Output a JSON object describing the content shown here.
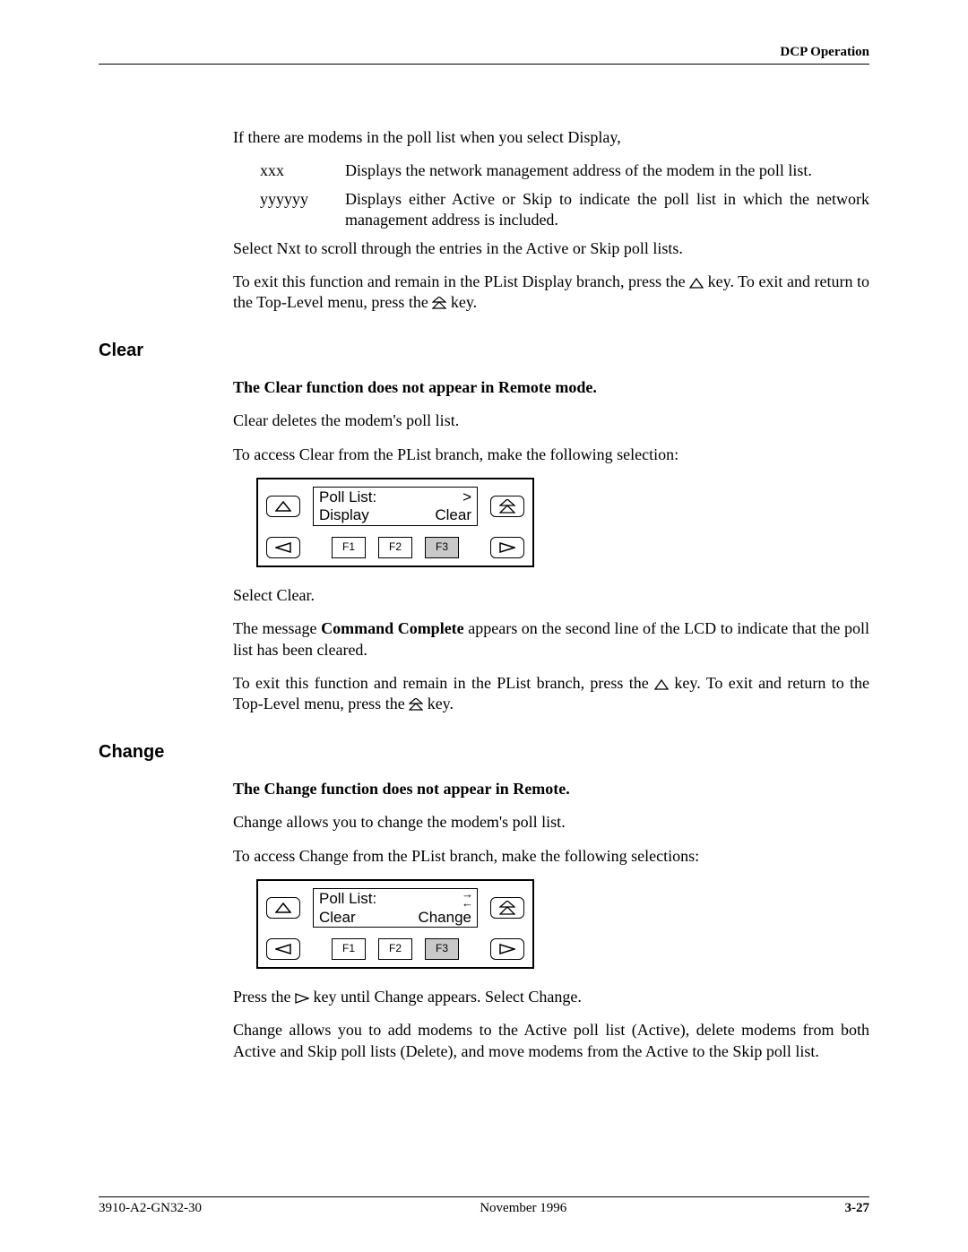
{
  "header": {
    "title": "DCP Operation"
  },
  "intro": {
    "p1": "If there are modems in the poll list when you select Display,",
    "defs": [
      {
        "term": "xxx",
        "def": "Displays the network management address of the modem in the poll list."
      },
      {
        "term": "yyyyyy",
        "def": "Displays either Active or Skip to indicate the poll list in which the network management address is included."
      }
    ],
    "p2": "Select Nxt to scroll through the entries in the Active or Skip poll lists.",
    "p3a": "To exit this function and remain in the PList Display branch, press the ",
    "p3b": " key. To exit and return to the Top-Level menu, press the ",
    "p3c": " key."
  },
  "clear": {
    "heading": "Clear",
    "note": "The Clear function does not appear in Remote mode.",
    "p1": "Clear deletes the modem's poll list.",
    "p2": "To access Clear from the PList branch, make the following selection:",
    "panel": {
      "line1_left": "Poll  List:",
      "line1_right": ">",
      "line2_left": "Display",
      "line2_right": "Clear",
      "f1": "F1",
      "f2": "F2",
      "f3": "F3",
      "selected": "F3"
    },
    "p3": "Select Clear.",
    "p4a": "The message ",
    "p4b": "Command Complete",
    "p4c": " appears on the second line of the LCD to indicate that the poll list has been cleared.",
    "p5a": "To exit this function and remain in the PList branch, press the ",
    "p5b": " key. To exit and return to the Top-Level menu, press the ",
    "p5c": " key."
  },
  "change": {
    "heading": "Change",
    "note": "The Change function does not appear in Remote.",
    "p1": "Change allows you to change the modem's poll list.",
    "p2": "To access Change from the PList branch, make the following selections:",
    "panel": {
      "line1_left": "Poll  List:",
      "line1_right_sym": "scroll",
      "line2_left": "Clear",
      "line2_right": "Change",
      "f1": "F1",
      "f2": "F2",
      "f3": "F3",
      "selected": "F3"
    },
    "p3a": "Press the ",
    "p3b": " key until Change appears. Select Change.",
    "p4": "Change allows you to add modems to the Active poll list (Active), delete modems from both Active and Skip poll lists (Delete), and move modems from the Active to the Skip poll list."
  },
  "footer": {
    "left": "3910-A2-GN32-30",
    "center": "November 1996",
    "right": "3-27"
  }
}
